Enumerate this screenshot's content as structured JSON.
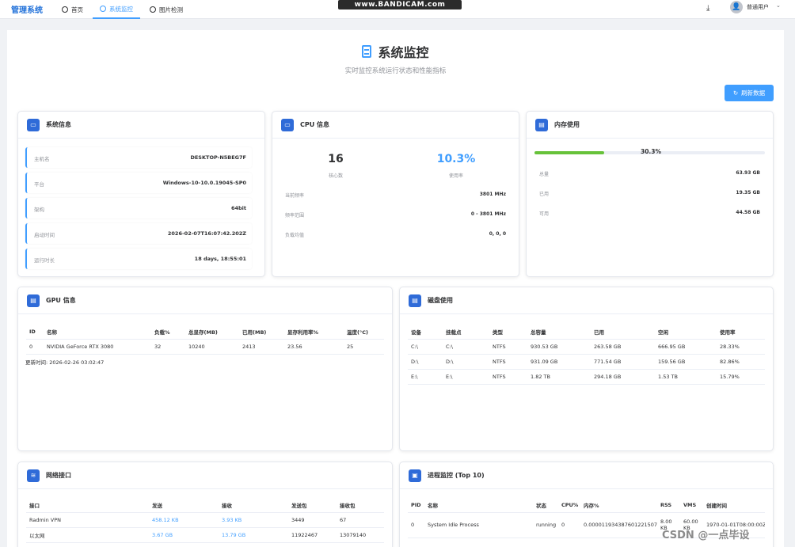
{
  "nav": {
    "brand": "管理系统",
    "tabs": [
      {
        "label": "首页"
      },
      {
        "label": "系统监控"
      },
      {
        "label": "图片检测"
      }
    ],
    "watermark": "www.BANDICAM.com",
    "user": "普通用户"
  },
  "page": {
    "title": "系统监控",
    "subtitle": "实时监控系统运行状态和性能指标",
    "refresh_label": "刷新数据"
  },
  "system_info": {
    "title": "系统信息",
    "rows": [
      {
        "label": "主机名",
        "value": "DESKTOP-N5BEG7F"
      },
      {
        "label": "平台",
        "value": "Windows-10-10.0.19045-SP0"
      },
      {
        "label": "架构",
        "value": "64bit"
      },
      {
        "label": "启动时间",
        "value": "2026-02-07T16:07:42.202Z"
      },
      {
        "label": "运行时长",
        "value": "18 days, 18:55:01"
      }
    ]
  },
  "cpu": {
    "title": "CPU 信息",
    "cores": "16",
    "cores_label": "核心数",
    "usage": "10.3%",
    "usage_label": "使用率",
    "rows": [
      {
        "label": "当前频率",
        "value": "3801 MHz"
      },
      {
        "label": "频率范围",
        "value": "0 - 3801 MHz"
      },
      {
        "label": "负载均值",
        "value": "0, 0, 0"
      }
    ]
  },
  "memory": {
    "title": "内存使用",
    "percent": 30.3,
    "percent_label": "30.3%",
    "rows": [
      {
        "label": "总量",
        "value": "63.93 GB"
      },
      {
        "label": "已用",
        "value": "19.35 GB"
      },
      {
        "label": "可用",
        "value": "44.58 GB"
      }
    ]
  },
  "gpu": {
    "title": "GPU 信息",
    "headers": [
      "ID",
      "名称",
      "负载%",
      "总显存(MB)",
      "已用(MB)",
      "显存利用率%",
      "温度(°C)"
    ],
    "rows": [
      [
        "0",
        "NVIDIA GeForce RTX 3080",
        "32",
        "10240",
        "2413",
        "23.56",
        "25"
      ]
    ],
    "updated": "更新时间:  2026-02-26 03:02:47"
  },
  "disk": {
    "title": "磁盘使用",
    "headers": [
      "设备",
      "挂载点",
      "类型",
      "总容量",
      "已用",
      "空闲",
      "使用率"
    ],
    "rows": [
      [
        "C:\\",
        "C:\\",
        "NTFS",
        "930.53 GB",
        "263.58 GB",
        "666.95 GB",
        "28.33%"
      ],
      [
        "D:\\",
        "D:\\",
        "NTFS",
        "931.09 GB",
        "771.54 GB",
        "159.56 GB",
        "82.86%"
      ],
      [
        "E:\\",
        "E:\\",
        "NTFS",
        "1.82 TB",
        "294.18 GB",
        "1.53 TB",
        "15.79%"
      ]
    ]
  },
  "network": {
    "title": "网络接口",
    "headers": [
      "接口",
      "发送",
      "接收",
      "发送包",
      "接收包"
    ],
    "rows": [
      [
        "Radmin VPN",
        "458.12 KB",
        "3.93 KB",
        "3449",
        "67"
      ],
      [
        "以太网",
        "3.67 GB",
        "13.79 GB",
        "11922467",
        "13079140"
      ]
    ]
  },
  "process": {
    "title": "进程监控 (Top 10)",
    "headers": [
      "PID",
      "名称",
      "状态",
      "CPU%",
      "内存%",
      "RSS",
      "VMS",
      "创建时间"
    ],
    "rows": [
      [
        "0",
        "System Idle Process",
        "running",
        "0",
        "0.000011934387601221507",
        "8.00 KB",
        "60.00 KB",
        "1970-01-01T08:00:00Z"
      ]
    ]
  },
  "csdn_watermark": "CSDN @一点毕设",
  "colors": {
    "accent": "#409eff",
    "icon_bg": "#2f6bd8",
    "progress": "#67c23a"
  }
}
